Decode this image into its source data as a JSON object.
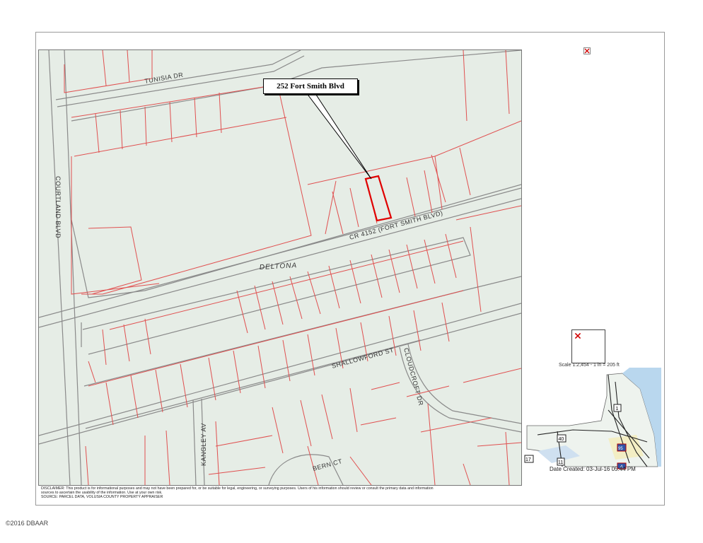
{
  "map": {
    "callout_label": "252 Fort Smith Blvd",
    "city_label": "DELTONA",
    "streets": {
      "tunisia": "TUNISIA DR",
      "courtland": "COURTLAND BLVD",
      "fort_smith": "CR 4152 (FORT SMITH BLVD)",
      "shallowford": "SHALLOWFORD ST",
      "cloudcroft": "CLOUDCROFT DR",
      "kangley": "KANGLEY AV",
      "bern": "BERN CT"
    },
    "colors": {
      "background": "#e6ede6",
      "parcel_line": "#e05050",
      "road_edge": "#8a8a8a",
      "highlight": "#e00000"
    }
  },
  "scale": {
    "text": "Scale 1:2,454 - 1 in = 205 ft"
  },
  "locator": {
    "date_created": "Date Created: 03-Jul-16 05:44 PM",
    "shields": [
      "1",
      "40",
      "11",
      "17",
      "95",
      "4"
    ]
  },
  "disclaimer": {
    "line1": "DISCLAIMER: This product is for informational purposes and may not have been prepared for, or be suitable for legal, engineering, or surveying purposes. Users of his information should review or consult the primary data and information",
    "line2": "sources to ascertain the usability of the information. Use at your own risk.",
    "line3": "SOURCE: PARCEL DATA, VOLUSIA COUNTY PROPERTY APPRAISER"
  },
  "footer": {
    "copyright": "©2016 DBAAR"
  }
}
